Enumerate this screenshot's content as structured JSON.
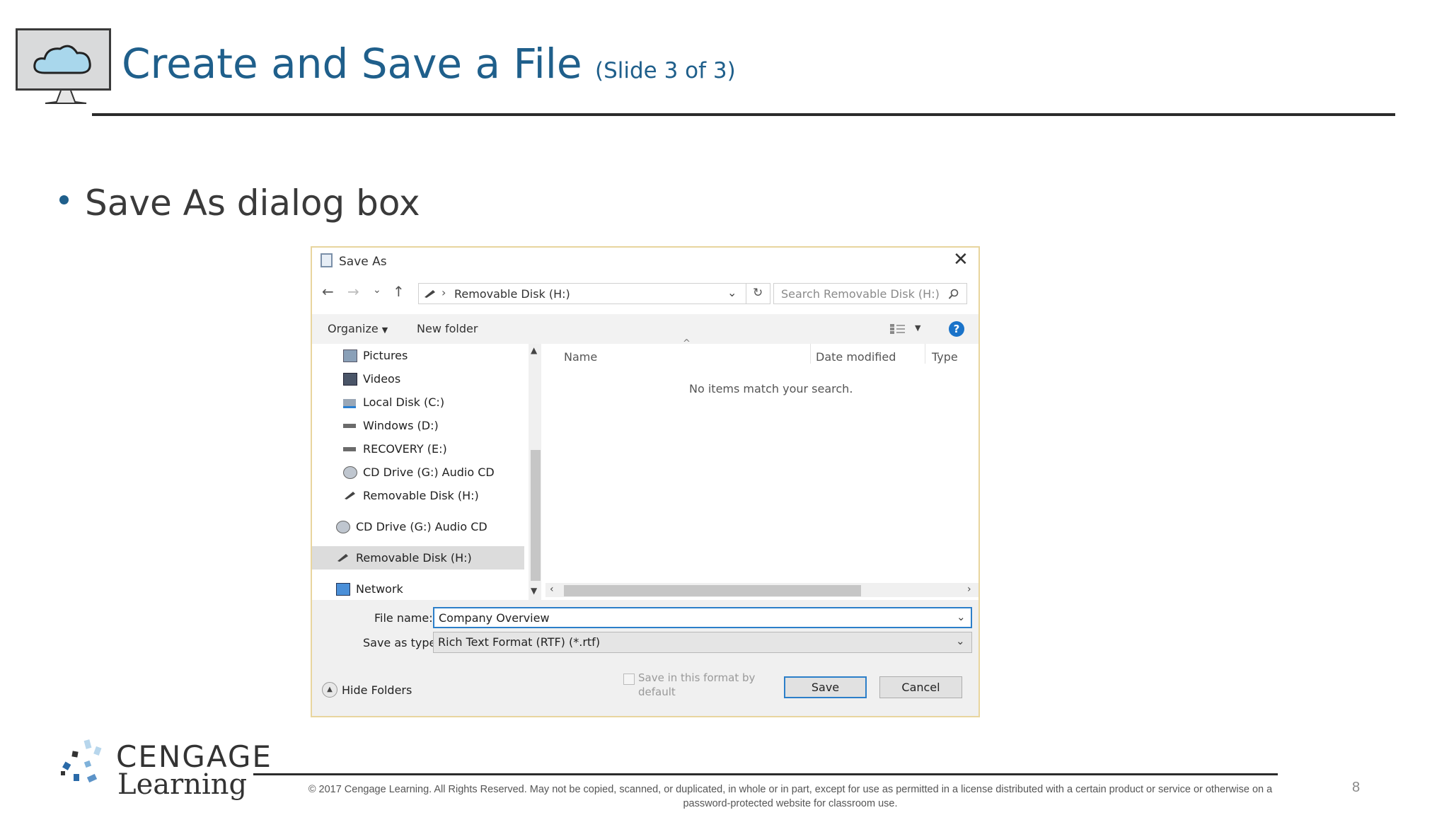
{
  "slide": {
    "title": "Create and Save a File",
    "subtitle": "(Slide 3 of 3)",
    "bullet": "Save As dialog box",
    "page_number": "8"
  },
  "dialog": {
    "title": "Save As",
    "close_glyph": "✕",
    "address": "Removable Disk (H:)",
    "search_placeholder": "Search Removable Disk (H:)",
    "toolbar": {
      "organize": "Organize",
      "new_folder": "New folder"
    },
    "nav_items": [
      {
        "label": "Pictures",
        "icon": "pictures-icon"
      },
      {
        "label": "Videos",
        "icon": "videos-icon"
      },
      {
        "label": "Local Disk (C:)",
        "icon": "local-disk-icon"
      },
      {
        "label": "Windows (D:)",
        "icon": "drive-icon"
      },
      {
        "label": "RECOVERY (E:)",
        "icon": "drive-icon"
      },
      {
        "label": "CD Drive (G:) Audio CD",
        "icon": "cd-drive-icon"
      },
      {
        "label": "Removable Disk (H:)",
        "icon": "removable-disk-icon"
      },
      {
        "label": "CD Drive (G:) Audio CD",
        "icon": "cd-drive-icon"
      },
      {
        "label": "Removable Disk (H:)",
        "icon": "removable-disk-icon",
        "selected": true
      },
      {
        "label": "Network",
        "icon": "network-icon"
      }
    ],
    "columns": [
      "Name",
      "Date modified",
      "Type"
    ],
    "empty_message": "No items match your search.",
    "file_name_label": "File name:",
    "file_name_value": "Company Overview",
    "save_type_label": "Save as type:",
    "save_type_value": "Rich Text Format (RTF) (*.rtf)",
    "save_default_label": "Save in this format by default",
    "save_default_line1": "Save in this format by",
    "save_default_line2": "default",
    "hide_folders": "Hide Folders",
    "save_button": "Save",
    "cancel_button": "Cancel"
  },
  "footer": {
    "brand_top": "CENGAGE",
    "brand_bottom": "Learning",
    "copyright_line1": "© 2017 Cengage Learning. All Rights Reserved. May not be copied, scanned, or duplicated, in whole or in part, except for use as permitted in a license distributed with a certain product or service or otherwise on a",
    "copyright_line2": "password-protected website for classroom use."
  },
  "colors": {
    "title_blue": "#1f5f8b",
    "focus_blue": "#2c7fc9",
    "help_blue": "#1a73c9"
  }
}
